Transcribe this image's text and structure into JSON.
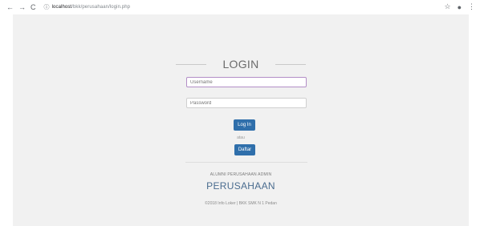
{
  "browser": {
    "url_host": "localhost",
    "url_path": "/bkk/perusahaan/login.php",
    "back_icon": "arrow-left-icon",
    "forward_icon": "arrow-right-icon",
    "reload_icon": "reload-icon"
  },
  "login": {
    "title": "LOGIN",
    "username_placeholder": "Username",
    "password_placeholder": "Password",
    "login_button": "Log In",
    "or_text": "atau",
    "register_button": "Daftar"
  },
  "footer": {
    "subtitle": "ALUMNI PERUSAHAAN ADMIN",
    "heading": "PERUSAHAAN",
    "copyright": "©2018 Info Loker | BKK SMK N 1 Pedan"
  },
  "colors": {
    "accent": "#2f6fab",
    "page_bg": "#f1f1f1"
  }
}
